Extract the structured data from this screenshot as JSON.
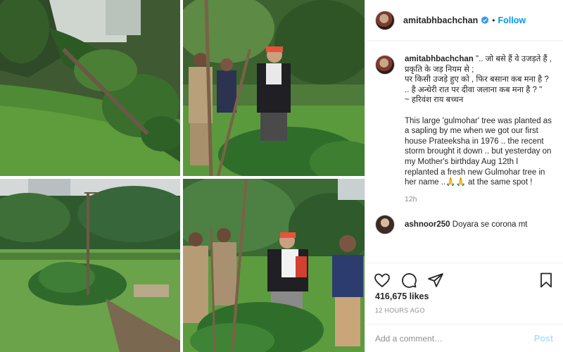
{
  "header": {
    "username": "amitabhbachchan",
    "separator": "•",
    "follow_label": "Follow",
    "avatar_icon": "profile-avatar",
    "verified_icon": "verified-badge-icon"
  },
  "caption": {
    "username": "amitabhbachchan",
    "text": "\".. जो बसे हैं वे उजड़ते हैं , प्रकृति के जड़ नियम से ;\nपर किसी उजड़े हुए को , फिर बसाना कब मना है ?\n.. है अन्धेरी रात पर दीवा जलाना कब मना है ? \"\n~ हरिवंश राय बच्चन\n\nThis large 'gulmohar' tree was planted as a sapling by me when we got our first house Prateeksha in 1976 .. the recent storm brought it down .. but yesterday on my Mother's birthday Aug 12th I replanted a fresh new Gulmohar tree in her name ..🙏🙏 at the same spot !",
    "time": "12h"
  },
  "next_comment": {
    "username": "ashnoor250",
    "text": "Doyara se corona mt"
  },
  "actions": {
    "icons": [
      "heart-icon",
      "comment-icon",
      "share-icon",
      "bookmark-icon"
    ]
  },
  "likes": "416,675 likes",
  "timestamp": "12 HOURS AGO",
  "add_comment": {
    "placeholder": "Add a comment…",
    "post_label": "Post"
  },
  "colors": {
    "accent": "#0095f6",
    "post_disabled": "#b2dffc",
    "muted": "#8e8e8e",
    "border": "#efefef"
  },
  "photos": [
    "fallen-gulmohar-tree-photo",
    "planting-sapling-photo",
    "new-sapling-garden-photo",
    "group-with-sapling-photo"
  ]
}
